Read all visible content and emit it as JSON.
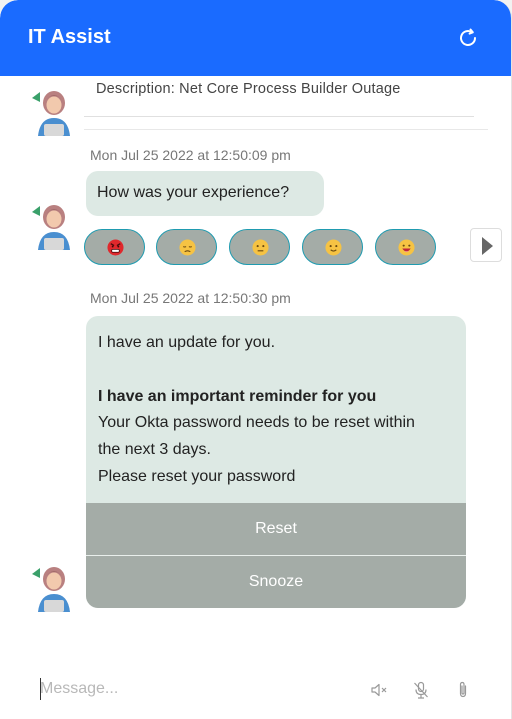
{
  "header": {
    "title": "IT Assist",
    "refresh_icon": "refresh-icon",
    "color": "#1a6bff"
  },
  "messages": {
    "description": "Description: Net Core Process Builder Outage",
    "first_timestamp": "Mon Jul 25 2022 at 12:50:09 pm",
    "question": "How was your experience?",
    "ratings": [
      "very-angry-face-icon",
      "sad-face-icon",
      "neutral-face-icon",
      "slight-smile-face-icon",
      "happy-face-icon"
    ],
    "second_timestamp": "Mon Jul 25 2022 at 12:50:30 pm",
    "update": {
      "line1": "I have an update for you.",
      "heading": "I have an important reminder for you",
      "line2": "Your Okta password needs to be reset within",
      "line3": "the next 3 days.",
      "line4": "Please reset your password",
      "reset_label": "Reset",
      "snooze_label": "Snooze"
    }
  },
  "composer": {
    "placeholder": "Message...",
    "icons": [
      "mute-icon",
      "microphone-off-icon",
      "paperclip-icon"
    ]
  },
  "colors": {
    "bubble": "#dde9e4",
    "button": "#a4aca7",
    "accent_border": "#1f9bb0"
  }
}
